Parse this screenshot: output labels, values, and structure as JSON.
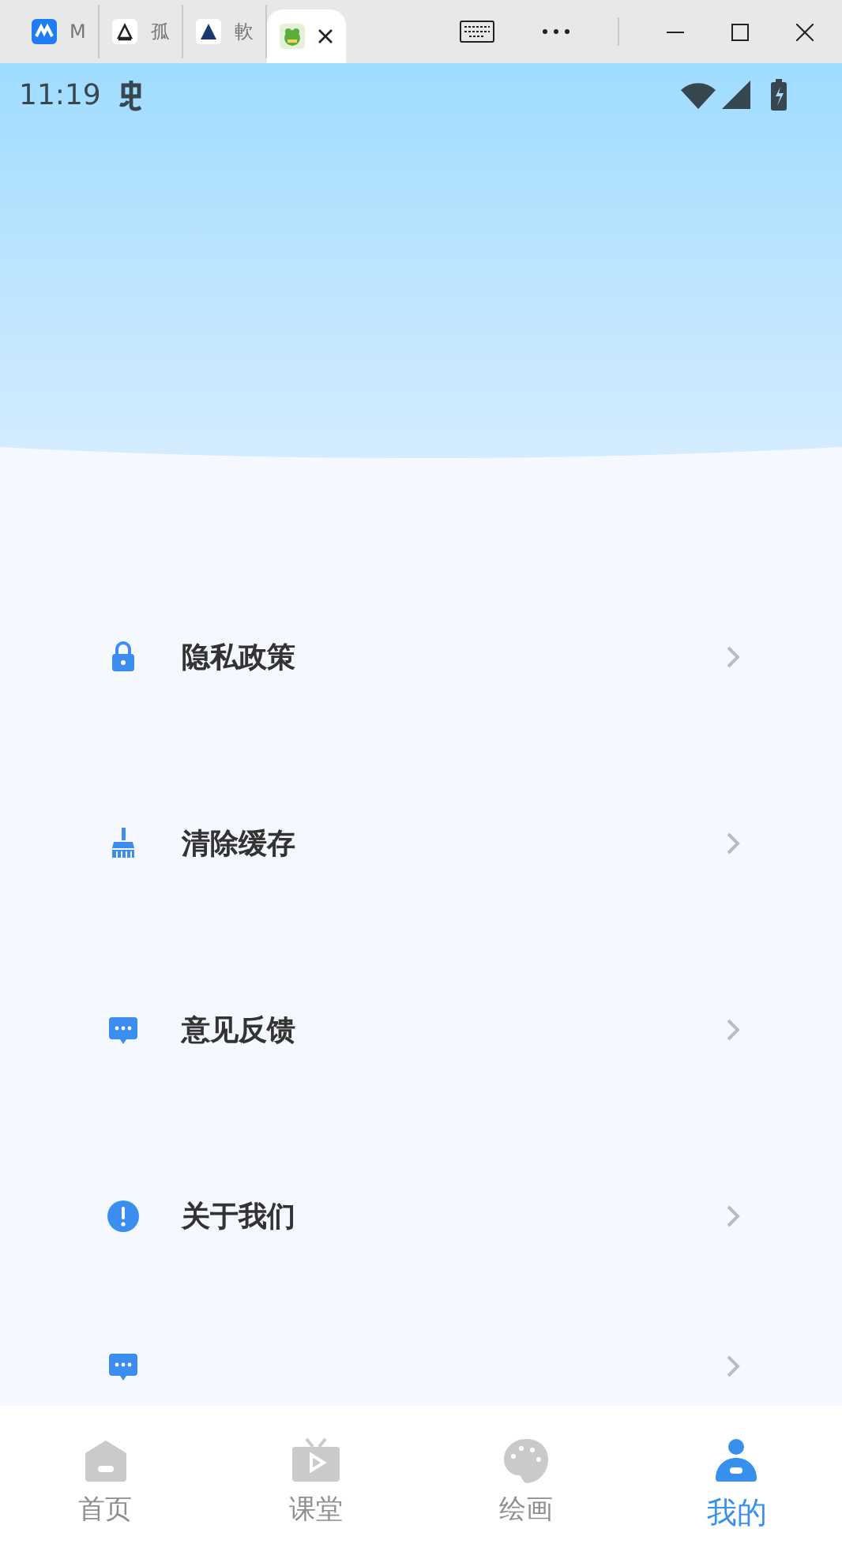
{
  "browser": {
    "tabs": [
      {
        "label": "M",
        "selected": false
      },
      {
        "label": "孤",
        "selected": false
      },
      {
        "label": "軟",
        "selected": false
      },
      {
        "selected": true
      }
    ]
  },
  "status_bar": {
    "time": "11:19"
  },
  "menu": [
    {
      "kind": "lock",
      "label": "隐私政策"
    },
    {
      "kind": "broom",
      "label": "清除缓存"
    },
    {
      "kind": "chat",
      "label": "意见反馈"
    },
    {
      "kind": "info",
      "label": "关于我们"
    },
    {
      "kind": "chat"
    }
  ],
  "nav": [
    {
      "kind": "home",
      "label": "首页",
      "selected": false
    },
    {
      "kind": "tv",
      "label": "课堂",
      "selected": false
    },
    {
      "kind": "palette",
      "label": "绘画",
      "selected": false
    },
    {
      "kind": "user",
      "label": "我的",
      "selected": true
    }
  ]
}
